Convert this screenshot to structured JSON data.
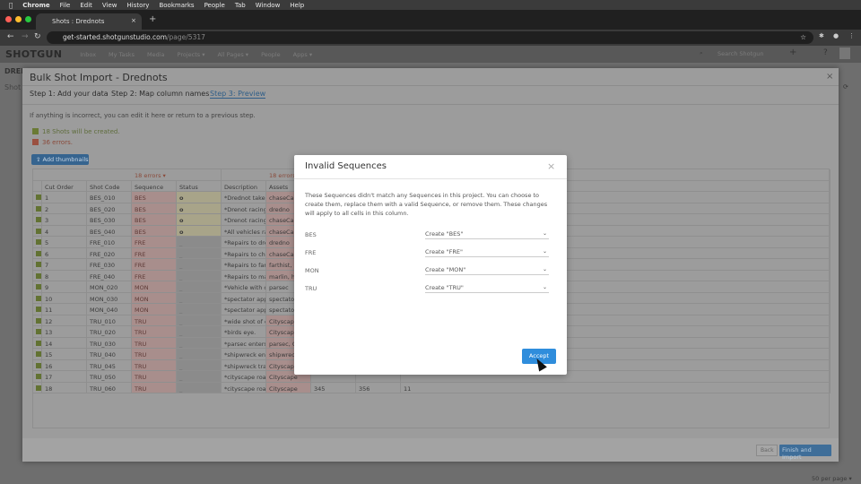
{
  "os_menu": {
    "app": "Chrome",
    "items": [
      "File",
      "Edit",
      "View",
      "History",
      "Bookmarks",
      "People",
      "Tab",
      "Window",
      "Help"
    ]
  },
  "browser": {
    "tab_title": "Shots : Drednots",
    "url_host": "get-started.shotgunstudio.com",
    "url_path": "/page/5317"
  },
  "sg_nav": {
    "logo": "SHOTGUN",
    "items": [
      "Inbox",
      "My Tasks",
      "Media",
      "Projects ▾",
      "All Pages ▾",
      "People",
      "Apps ▾"
    ],
    "search_placeholder": "Search Shotgun"
  },
  "background_page": {
    "project": "DRED",
    "page": "Shot",
    "per_page": "50 per page ▾"
  },
  "bulk": {
    "title": "Bulk Shot Import - Drednots",
    "steps": [
      "Step 1: Add your data",
      "Step 2: Map column names",
      "Step 3: Preview"
    ],
    "hint": "If anything is incorrect, you can edit it here or return to a previous step.",
    "created": "18 Shots will be created.",
    "errors": "36 errors.",
    "add_thumbnails": "Add thumbnails",
    "seq_errors": "18 errors ▾",
    "asset_errors": "18 errors",
    "columns": [
      "Cut Order",
      "Shot Code",
      "Sequence",
      "Status",
      "Description",
      "Assets"
    ],
    "rows": [
      [
        "1",
        "BES_010",
        "BES",
        "o",
        "*Drednot takes off",
        "chaseCam,"
      ],
      [
        "2",
        "BES_020",
        "BES",
        "o",
        "*Drenot racing on",
        "dredno"
      ],
      [
        "3",
        "BES_030",
        "BES",
        "o",
        "*Drenot racing on",
        "chaseCam,"
      ],
      [
        "4",
        "BES_040",
        "BES",
        "o",
        "*All vehicles racing",
        "chaseCam,"
      ],
      [
        "5",
        "FRE_010",
        "FRE",
        "_",
        "*Repairs to drednot",
        "dredno"
      ],
      [
        "6",
        "FRE_020",
        "FRE",
        "_",
        "*Repairs to chaseCam",
        "chaseCam,"
      ],
      [
        "7",
        "FRE_030",
        "FRE",
        "_",
        "*Repairs to farthist",
        "farthist, ha"
      ],
      [
        "8",
        "FRE_040",
        "FRE",
        "_",
        "*Repairs to marlin",
        "marlin, ha"
      ],
      [
        "9",
        "MON_020",
        "MON",
        "_",
        "*Vehicle with city",
        "parsec"
      ],
      [
        "10",
        "MON_030",
        "MON",
        "_",
        "*spectator appears",
        "spectator"
      ],
      [
        "11",
        "MON_040",
        "MON",
        "_",
        "*spectator appears",
        "spectator"
      ],
      [
        "12",
        "TRU_010",
        "TRU",
        "_",
        "*wide shot of city",
        "Cityscape"
      ],
      [
        "13",
        "TRU_020",
        "TRU",
        "_",
        "*birds eye.",
        "Cityscape"
      ],
      [
        "14",
        "TRU_030",
        "TRU",
        "_",
        "*parsec enters.",
        "parsec, Cit"
      ],
      [
        "15",
        "TRU_040",
        "TRU",
        "_",
        "*shipwreck enters",
        "shipwreck,"
      ],
      [
        "16",
        "TRU_045",
        "TRU",
        "_",
        "*shipwreck trailing",
        "Cityscape,"
      ],
      [
        "17",
        "TRU_050",
        "TRU",
        "_",
        "*cityscape roads",
        "Cityscape"
      ],
      [
        "18",
        "TRU_060",
        "TRU",
        "_",
        "*cityscape roads",
        "Cityscape"
      ]
    ],
    "row18_extra": [
      "345",
      "356",
      "11"
    ],
    "back": "Back",
    "finish": "Finish and Import"
  },
  "modal": {
    "title": "Invalid Sequences",
    "description": "These Sequences didn't match any Sequences in this project. You can choose to create them, replace them with a valid Sequence, or remove them. These changes will apply to all cells in this column.",
    "mappings": [
      {
        "code": "BES",
        "action": "Create \"BES\""
      },
      {
        "code": "FRE",
        "action": "Create \"FRE\""
      },
      {
        "code": "MON",
        "action": "Create \"MON\""
      },
      {
        "code": "TRU",
        "action": "Create \"TRU\""
      }
    ],
    "accept": "Accept"
  },
  "colors": {
    "accent": "#2f8ddc",
    "error": "#c0503e",
    "success": "#7a9a3a"
  }
}
